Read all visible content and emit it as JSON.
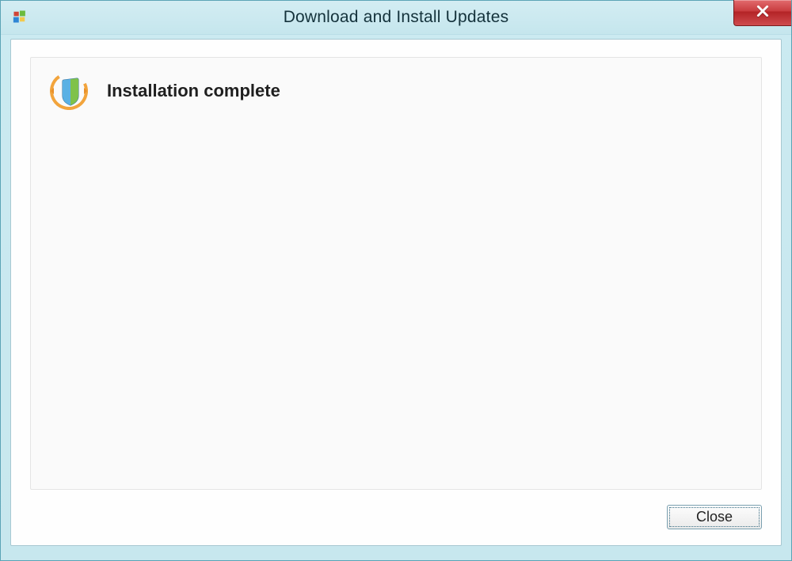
{
  "window": {
    "title": "Download and Install Updates"
  },
  "main": {
    "heading": "Installation complete"
  },
  "buttons": {
    "close": "Close"
  }
}
